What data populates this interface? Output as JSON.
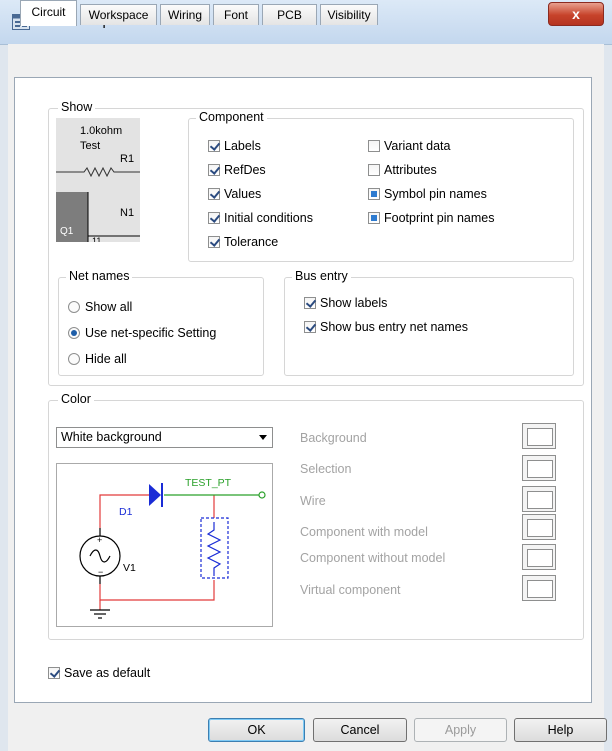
{
  "window": {
    "title": "Sheet Properties",
    "close_label": "x"
  },
  "tabs": [
    {
      "label": "Circuit"
    },
    {
      "label": "Workspace"
    },
    {
      "label": "Wiring"
    },
    {
      "label": "Font"
    },
    {
      "label": "PCB"
    },
    {
      "label": "Visibility"
    }
  ],
  "show": {
    "legend": "Show",
    "preview": {
      "value_label": "1.0kohm",
      "name_label": "Test",
      "refdes_r": "R1",
      "net_label": "N1",
      "refdes_q": "Q1",
      "pin_label": "11"
    },
    "component": {
      "legend": "Component",
      "items": [
        {
          "label": "Labels",
          "state": "checked"
        },
        {
          "label": "RefDes",
          "state": "checked"
        },
        {
          "label": "Values",
          "state": "checked"
        },
        {
          "label": "Initial conditions",
          "state": "checked"
        },
        {
          "label": "Tolerance",
          "state": "checked"
        },
        {
          "label": "Variant data",
          "state": "unchecked"
        },
        {
          "label": "Attributes",
          "state": "unchecked"
        },
        {
          "label": "Symbol pin names",
          "state": "indeterminate"
        },
        {
          "label": "Footprint pin names",
          "state": "indeterminate"
        }
      ]
    },
    "net_names": {
      "legend": "Net names",
      "options": [
        {
          "label": "Show all",
          "selected": false
        },
        {
          "label": "Use net-specific Setting",
          "selected": true
        },
        {
          "label": "Hide all",
          "selected": false
        }
      ]
    },
    "bus_entry": {
      "legend": "Bus entry",
      "items": [
        {
          "label": "Show labels",
          "state": "checked"
        },
        {
          "label": "Show bus entry net names",
          "state": "checked"
        }
      ]
    }
  },
  "color": {
    "legend": "Color",
    "scheme": "White background",
    "schematic": {
      "diode": "D1",
      "source": "V1",
      "test_point": "TEST_PT"
    },
    "items": [
      {
        "label": "Background"
      },
      {
        "label": "Selection"
      },
      {
        "label": "Wire"
      },
      {
        "label": "Component with model"
      },
      {
        "label": "Component without model"
      },
      {
        "label": "Virtual component"
      }
    ],
    "colors": {
      "wire": "#e23b3b",
      "component": "#1a2cd6",
      "test_point": "#2aa02a"
    }
  },
  "save_default": {
    "label": "Save as default",
    "state": "checked"
  },
  "buttons": {
    "ok": "OK",
    "cancel": "Cancel",
    "apply": "Apply",
    "help": "Help"
  }
}
